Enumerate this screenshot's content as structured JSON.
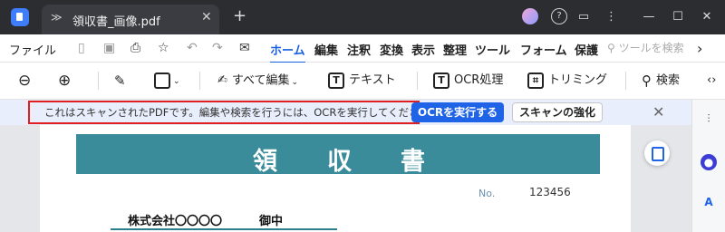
{
  "tab": {
    "title": "領収書_画像.pdf"
  },
  "menu": {
    "file": "ファイル",
    "tabs": [
      {
        "label": "ホーム",
        "active": true
      },
      {
        "label": "編集"
      },
      {
        "label": "注釈"
      },
      {
        "label": "変換"
      },
      {
        "label": "表示"
      },
      {
        "label": "整理"
      },
      {
        "label": "ツール"
      },
      {
        "label": "フォーム"
      },
      {
        "label": "保護"
      }
    ],
    "search_placeholder": "ツールを検索",
    "more": "›"
  },
  "toolbar": {
    "edit_all": "すべて編集",
    "text": "テキスト",
    "ocr": "OCR処理",
    "trim": "トリミング",
    "search": "検索"
  },
  "notice": {
    "message": "これはスキャンされたPDFです。編集や検索を行うには、OCRを実行してください。",
    "run_ocr": "OCRを実行する",
    "enhance": "スキャンの強化"
  },
  "document": {
    "title_chars": [
      "領",
      "収",
      "書"
    ],
    "no_label": "No.",
    "no_value": "123456",
    "company": "株式会社〇〇〇〇",
    "honorific": "御中"
  },
  "colors": {
    "accent": "#1f63e6",
    "banner": "#3a8c9a",
    "titlebar": "#2b2d31",
    "highlight_border": "#e02020"
  }
}
